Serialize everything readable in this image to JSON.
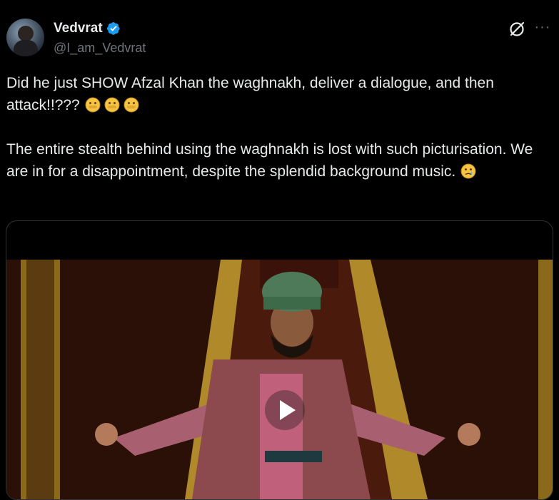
{
  "author": {
    "display_name": "Vedvrat",
    "handle": "@I_am_Vedvrat",
    "verified": true
  },
  "header_icons": [
    "grok-icon",
    "more-icon"
  ],
  "more_glyph": "···",
  "tweet": {
    "paragraph_1": "Did he just SHOW Afzal Khan the waghnakh, deliver a dialogue, and then attack!!???",
    "paragraph_1_emojis": [
      "mouth-covering-emoji",
      "mouth-covering-emoji",
      "mouth-covering-emoji"
    ],
    "paragraph_2": "The entire stealth behind using the waghnakh is lost with such picturisation. We are in for a disappointment, despite the splendid background music.",
    "paragraph_2_emoji": "crying-face-emoji"
  },
  "media": {
    "type": "video",
    "play_icon": "play-icon"
  },
  "colors": {
    "background": "#000000",
    "text": "#e7e9ea",
    "secondary": "#71767b",
    "verified": "#1d9bf0",
    "border": "#2f3336"
  }
}
